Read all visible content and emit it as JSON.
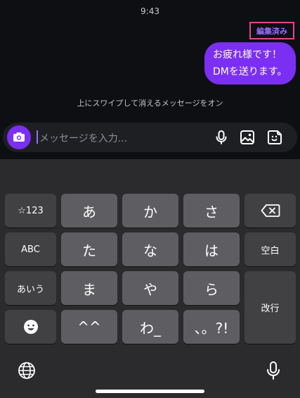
{
  "status": {
    "time": "9:43"
  },
  "chat": {
    "edited_label": "編集済み",
    "message_lines": [
      "お疲れ様です！",
      "DMを送ります。"
    ],
    "vanish_notice": "上にスワイプして消えるメッセージをオン"
  },
  "composer": {
    "placeholder": "メッセージを入力..."
  },
  "icons": [
    "camera-icon",
    "microphone-icon",
    "gallery-icon",
    "sticker-icon",
    "globe-icon",
    "microphone-icon",
    "backspace-icon",
    "emoji-icon"
  ],
  "keyboard": {
    "row1": {
      "left": "☆123",
      "k1": "あ",
      "k2": "か",
      "k3": "さ"
    },
    "row2": {
      "left": "ABC",
      "k1": "た",
      "k2": "な",
      "k3": "は",
      "right": "空白"
    },
    "row3": {
      "left": "あいう",
      "k1": "ま",
      "k2": "や",
      "k3": "ら",
      "right": "改行"
    },
    "row4": {
      "k1": "^^",
      "k2": "わ_",
      "k3": "、。?!"
    }
  },
  "colors": {
    "accent": "#7b2ff2",
    "edited_border": "#e4488d",
    "background": "#0e0f12",
    "keyboard_bg": "#2b2b2d"
  }
}
